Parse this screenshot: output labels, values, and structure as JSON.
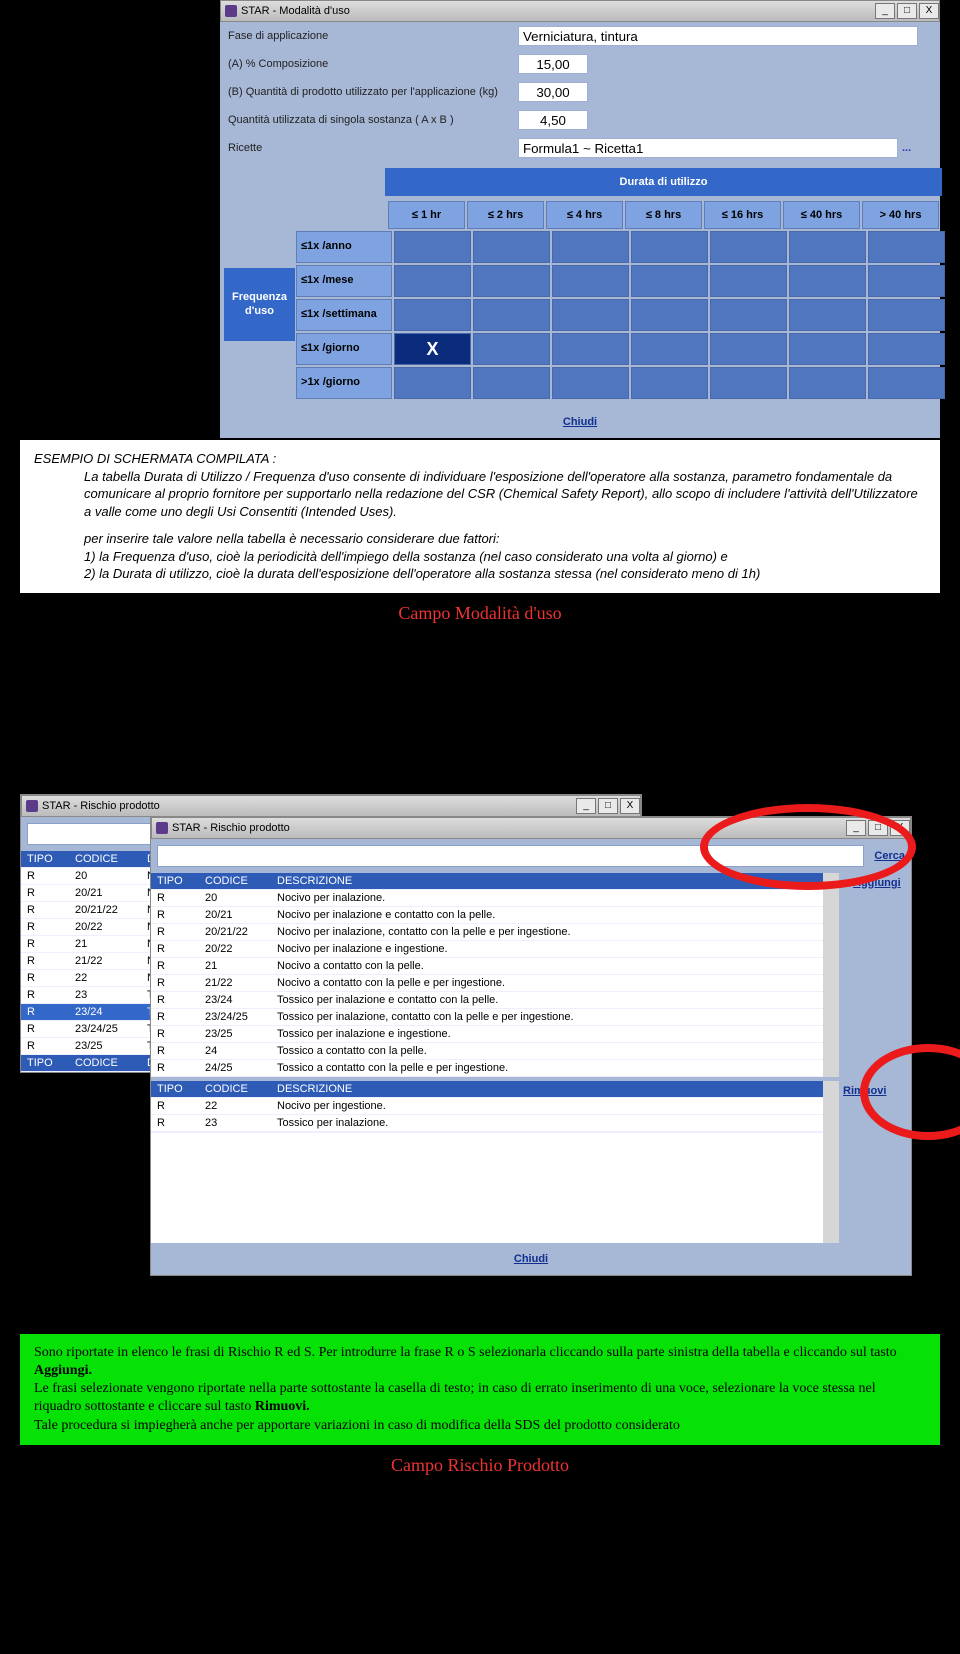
{
  "slide1": {
    "window_title": "STAR - Modalità d'uso",
    "fields": {
      "fase_label": "Fase di applicazione",
      "fase_value": "Verniciatura, tintura",
      "a_label": "(A) % Composizione",
      "a_value": "15,00",
      "b_label": "(B) Quantità di prodotto utilizzato per l'applicazione (kg)",
      "b_value": "30,00",
      "ab_label": "Quantità utilizzata di singola sostanza ( A x B )",
      "ab_value": "4,50",
      "ricette_label": "Ricette",
      "ricette_value": "Formula1 ~ Ricetta1"
    },
    "axis_x_title": "Durata di utilizzo",
    "axis_y_title": "Frequenza d'uso",
    "cols": {
      "c1": "≤ 1 hr",
      "c2": "≤ 2 hrs",
      "c3": "≤ 4 hrs",
      "c4": "≤ 8 hrs",
      "c5": "≤ 16 hrs",
      "c6": "≤ 40 hrs",
      "c7": "> 40 hrs"
    },
    "rows": {
      "r1": "≤1x /anno",
      "r2": "≤1x /mese",
      "r3": "≤1x /settimana",
      "r4": "≤1x /giorno",
      "r5": ">1x /giorno"
    },
    "selected_mark": "X",
    "chiudi": "Chiudi",
    "explain_title": "ESEMPIO DI SCHERMATA COMPILATA :",
    "explain_p1": "La tabella Durata di Utilizzo / Frequenza d'uso consente di individuare l'esposizione dell'operatore alla sostanza, parametro fondamentale da comunicare al proprio fornitore per supportarlo nella redazione del CSR (Chemical Safety Report), allo scopo di includere l'attività dell'Utilizzatore a valle come uno degli Usi Consentiti (Intended Uses).",
    "explain_p2": "per inserire tale valore nella tabella è necessario considerare due fattori:",
    "explain_li1": "1) la Frequenza d'uso, cioè la periodicità dell'impiego della sostanza (nel caso considerato una volta al giorno) e",
    "explain_li2": "2) la Durata di utilizzo, cioè la durata dell'esposizione dell'operatore alla sostanza stessa (nel considerato meno di 1h)",
    "caption": "Campo Modalità d'uso"
  },
  "slide2": {
    "window_title": "STAR - Rischio prodotto",
    "search_link": "Cerca",
    "add_link": "Aggiungi",
    "remove_link": "Rimuovi",
    "chiudi": "Chiudi",
    "col_tipo": "TIPO",
    "col_codice": "CODICE",
    "col_descr": "DESCRIZIONE",
    "back_table": {
      "rows": [
        {
          "t": "R",
          "c": "20",
          "d": "Noci"
        },
        {
          "t": "R",
          "c": "20/21",
          "d": "Noci"
        },
        {
          "t": "R",
          "c": "20/21/22",
          "d": "Noci"
        },
        {
          "t": "R",
          "c": "20/22",
          "d": "Noci"
        },
        {
          "t": "R",
          "c": "21",
          "d": "Noci"
        },
        {
          "t": "R",
          "c": "21/22",
          "d": "Noci"
        },
        {
          "t": "R",
          "c": "22",
          "d": "Noci"
        },
        {
          "t": "R",
          "c": "23",
          "d": "Toss"
        },
        {
          "t": "R",
          "c": "23/24",
          "d": "Toss"
        },
        {
          "t": "R",
          "c": "23/24/25",
          "d": "Toss"
        },
        {
          "t": "R",
          "c": "23/25",
          "d": "Toss"
        }
      ]
    },
    "front_table": {
      "rows": [
        {
          "t": "R",
          "c": "20",
          "d": "Nocivo per inalazione."
        },
        {
          "t": "R",
          "c": "20/21",
          "d": "Nocivo per inalazione e contatto con la pelle."
        },
        {
          "t": "R",
          "c": "20/21/22",
          "d": "Nocivo per inalazione, contatto con la pelle e per ingestione."
        },
        {
          "t": "R",
          "c": "20/22",
          "d": "Nocivo per inalazione e ingestione."
        },
        {
          "t": "R",
          "c": "21",
          "d": "Nocivo a contatto con la pelle."
        },
        {
          "t": "R",
          "c": "21/22",
          "d": "Nocivo a contatto con la pelle e per ingestione."
        },
        {
          "t": "R",
          "c": "23/24",
          "d": "Tossico per inalazione e contatto con la pelle."
        },
        {
          "t": "R",
          "c": "23/24/25",
          "d": "Tossico per inalazione, contatto con la pelle e per ingestione."
        },
        {
          "t": "R",
          "c": "23/25",
          "d": "Tossico per inalazione e ingestione."
        },
        {
          "t": "R",
          "c": "24",
          "d": "Tossico a contatto con la pelle."
        },
        {
          "t": "R",
          "c": "24/25",
          "d": "Tossico a contatto con la pelle e per ingestione."
        }
      ]
    },
    "lower_table": {
      "rows": [
        {
          "t": "R",
          "c": "22",
          "d": "Nocivo per ingestione."
        },
        {
          "t": "R",
          "c": "23",
          "d": "Tossico per inalazione."
        }
      ]
    },
    "green_p1": "Sono riportate in elenco le frasi di Rischio R ed S. Per introdurre la frase R o S selezionarla cliccando sulla parte sinistra della tabella e cliccando sul tasto ",
    "green_b1": "Aggiungi.",
    "green_p2": "Le frasi selezionate vengono riportate nella parte sottostante la casella di testo; in caso di errato inserimento di una voce, selezionare la voce stessa nel riquadro sottostante e cliccare sul tasto ",
    "green_b2": "Rimuovi.",
    "green_p3": "Tale procedura si impiegherà anche per apportare variazioni in caso di  modifica della SDS del prodotto considerato",
    "caption": "Campo Rischio Prodotto"
  },
  "wm": {
    "min": "_",
    "max": "□",
    "close": "X"
  }
}
